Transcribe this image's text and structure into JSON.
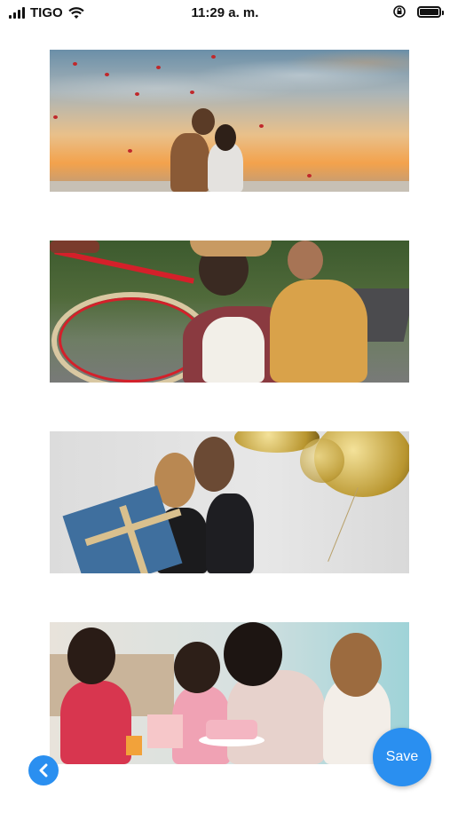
{
  "status_bar": {
    "carrier": "TIGO",
    "time": "11:29 a. m.",
    "icons": [
      "signal-icon",
      "wifi-icon",
      "orientation-lock-icon",
      "battery-icon"
    ]
  },
  "photos": [
    {
      "name": "couple-sunset-photo"
    },
    {
      "name": "couple-bicycle-photo"
    },
    {
      "name": "party-friends-photo"
    },
    {
      "name": "birthday-party-photo"
    }
  ],
  "actions": {
    "back_icon": "chevron-left-icon",
    "save_label": "Save"
  },
  "colors": {
    "accent": "#2a8ff0",
    "background": "#ffffff"
  }
}
